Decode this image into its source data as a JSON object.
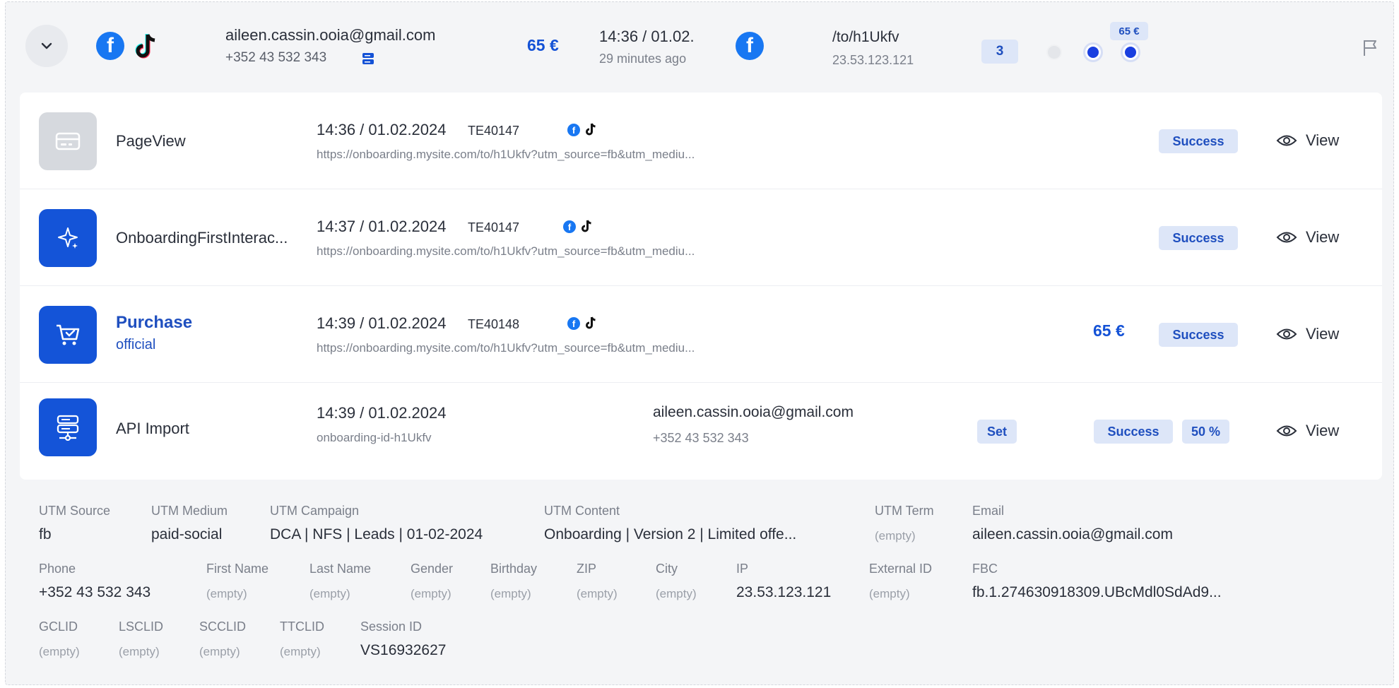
{
  "header": {
    "email": "aileen.cassin.ooia@gmail.com",
    "phone": "+352 43 532 343",
    "amount": "65 €",
    "time": "14:36 / 01.02.",
    "ago": "29 minutes ago",
    "fb_letter": "f",
    "path": "/to/h1Ukfv",
    "ip": "23.53.123.121",
    "count": "3",
    "mini_badge": "65 €",
    "colors": {
      "accent": "#1452d6",
      "facebook": "#1877f2",
      "badge_bg": "#dde6f8"
    }
  },
  "events": [
    {
      "name": "PageView",
      "sub": "",
      "icon": "credit-card-icon",
      "time": "14:36 / 01.02.2024",
      "code": "TE40147",
      "url": "https://onboarding.mysite.com/to/h1Ukfv?utm_source=fb&utm_mediu...",
      "amount": "",
      "status": "Success",
      "view": "View"
    },
    {
      "name": "OnboardingFirstInterac...",
      "sub": "",
      "icon": "sparkle-icon",
      "time": "14:37 / 01.02.2024",
      "code": "TE40147",
      "url": "https://onboarding.mysite.com/to/h1Ukfv?utm_source=fb&utm_mediu...",
      "amount": "",
      "status": "Success",
      "view": "View"
    },
    {
      "name": "Purchase",
      "sub": "official",
      "icon": "cart-icon",
      "time": "14:39 / 01.02.2024",
      "code": "TE40148",
      "url": "https://onboarding.mysite.com/to/h1Ukfv?utm_source=fb&utm_mediu...",
      "amount": "65 €",
      "status": "Success",
      "view": "View"
    },
    {
      "name": "API Import",
      "sub": "",
      "icon": "server-icon",
      "time": "14:39 / 01.02.2024",
      "id": "onboarding-id-h1Ukfv",
      "email": "aileen.cassin.ooia@gmail.com",
      "phone": "+352 43 532 343",
      "set": "Set",
      "status": "Success",
      "percent": "50 %",
      "view": "View"
    }
  ],
  "details": {
    "row1": [
      {
        "label": "UTM Source",
        "value": "fb"
      },
      {
        "label": "UTM Medium",
        "value": "paid-social"
      },
      {
        "label": "UTM Campaign",
        "value": "DCA | NFS | Leads | 01-02-2024"
      },
      {
        "label": "UTM Content",
        "value": "Onboarding | Version 2 | Limited offe..."
      },
      {
        "label": "UTM Term",
        "value": "(empty)"
      },
      {
        "label": "Email",
        "value": "aileen.cassin.ooia@gmail.com"
      }
    ],
    "row2": [
      {
        "label": "Phone",
        "value": "+352 43 532 343"
      },
      {
        "label": "First Name",
        "value": "(empty)"
      },
      {
        "label": "Last Name",
        "value": "(empty)"
      },
      {
        "label": "Gender",
        "value": "(empty)"
      },
      {
        "label": "Birthday",
        "value": "(empty)"
      },
      {
        "label": "ZIP",
        "value": "(empty)"
      },
      {
        "label": "City",
        "value": "(empty)"
      },
      {
        "label": "IP",
        "value": "23.53.123.121"
      },
      {
        "label": "External ID",
        "value": "(empty)"
      },
      {
        "label": "FBC",
        "value": "fb.1.274630918309.UBcMdl0SdAd9..."
      }
    ],
    "row3": [
      {
        "label": "GCLID",
        "value": "(empty)"
      },
      {
        "label": "LSCLID",
        "value": "(empty)"
      },
      {
        "label": "SCCLID",
        "value": "(empty)"
      },
      {
        "label": "TTCLID",
        "value": "(empty)"
      },
      {
        "label": "Session ID",
        "value": "VS16932627"
      }
    ]
  }
}
